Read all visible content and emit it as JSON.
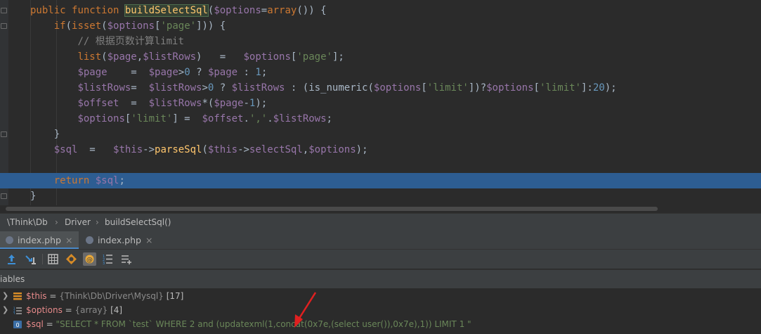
{
  "editor": {
    "lines": [
      [
        [
          "kw",
          "public "
        ],
        [
          "kw",
          "function "
        ],
        [
          "ident",
          "buildSelectSql"
        ],
        [
          "",
          "("
        ],
        [
          "var",
          "$options"
        ],
        [
          "",
          "="
        ],
        [
          "kw",
          "array"
        ],
        [
          "",
          "()) {"
        ]
      ],
      [
        [
          "",
          "    "
        ],
        [
          "kw",
          "if"
        ],
        [
          "",
          "("
        ],
        [
          "kw",
          "isset"
        ],
        [
          "",
          "("
        ],
        [
          "var",
          "$options"
        ],
        [
          "",
          "["
        ],
        [
          "str",
          "'page'"
        ],
        [
          "",
          "])) {"
        ]
      ],
      [
        [
          "",
          "        "
        ],
        [
          "cmt",
          "// 根据页数计算limit"
        ]
      ],
      [
        [
          "",
          "        "
        ],
        [
          "kw",
          "list"
        ],
        [
          "",
          "("
        ],
        [
          "var",
          "$page"
        ],
        [
          "",
          ","
        ],
        [
          "var",
          "$listRows"
        ],
        [
          "",
          ")   =   "
        ],
        [
          "var",
          "$options"
        ],
        [
          "",
          "["
        ],
        [
          "str",
          "'page'"
        ],
        [
          "",
          "];"
        ]
      ],
      [
        [
          "",
          "        "
        ],
        [
          "var",
          "$page"
        ],
        [
          "",
          "    =  "
        ],
        [
          "var",
          "$page"
        ],
        [
          "",
          ">"
        ],
        [
          "num",
          "0"
        ],
        [
          "",
          " ? "
        ],
        [
          "var",
          "$page"
        ],
        [
          "",
          " : "
        ],
        [
          "num",
          "1"
        ],
        [
          "",
          ";"
        ]
      ],
      [
        [
          "",
          "        "
        ],
        [
          "var",
          "$listRows"
        ],
        [
          "",
          "=  "
        ],
        [
          "var",
          "$listRows"
        ],
        [
          "",
          ">"
        ],
        [
          "num",
          "0"
        ],
        [
          "",
          " ? "
        ],
        [
          "var",
          "$listRows"
        ],
        [
          "",
          " : (is_numeric("
        ],
        [
          "var",
          "$options"
        ],
        [
          "",
          "["
        ],
        [
          "str",
          "'limit'"
        ],
        [
          "",
          "])?"
        ],
        [
          "var",
          "$options"
        ],
        [
          "",
          "["
        ],
        [
          "str",
          "'limit'"
        ],
        [
          "",
          "]:"
        ],
        [
          "num",
          "20"
        ],
        [
          "",
          ");"
        ]
      ],
      [
        [
          "",
          "        "
        ],
        [
          "var",
          "$offset"
        ],
        [
          "",
          "  =  "
        ],
        [
          "var",
          "$listRows"
        ],
        [
          "",
          "*("
        ],
        [
          "var",
          "$page"
        ],
        [
          "",
          "-"
        ],
        [
          "num",
          "1"
        ],
        [
          "",
          ");"
        ]
      ],
      [
        [
          "",
          "        "
        ],
        [
          "var",
          "$options"
        ],
        [
          "",
          "["
        ],
        [
          "str",
          "'limit'"
        ],
        [
          "",
          "] =  "
        ],
        [
          "var",
          "$offset"
        ],
        [
          "",
          "."
        ],
        [
          "str",
          "','"
        ],
        [
          "",
          "."
        ],
        [
          "var",
          "$listRows"
        ],
        [
          "",
          ";"
        ]
      ],
      [
        [
          "",
          "    }"
        ]
      ],
      [
        [
          "",
          "    "
        ],
        [
          "var",
          "$sql"
        ],
        [
          "",
          "  =   "
        ],
        [
          "var",
          "$this"
        ],
        [
          "",
          "->"
        ],
        [
          "fn",
          "parseSql"
        ],
        [
          "",
          "("
        ],
        [
          "var",
          "$this"
        ],
        [
          "",
          "->"
        ],
        [
          "var",
          "selectSql"
        ],
        [
          "",
          ","
        ],
        [
          "var",
          "$options"
        ],
        [
          "",
          ");"
        ]
      ],
      [
        [
          "",
          ""
        ]
      ],
      [
        [
          "",
          "    "
        ],
        [
          "kw",
          "return "
        ],
        [
          "var",
          "$sql"
        ],
        [
          "",
          ";"
        ]
      ],
      [
        [
          "",
          "}"
        ]
      ]
    ],
    "highlighted_line": 11
  },
  "breadcrumb": [
    "\\Think\\Db",
    "Driver",
    "buildSelectSql()"
  ],
  "tabs": [
    {
      "label": "index.php",
      "close": "×"
    },
    {
      "label": "index.php",
      "close": "×"
    }
  ],
  "panel": {
    "header": "iables",
    "variables": [
      {
        "name": "$this",
        "eq": " = ",
        "type": "{Think\\Db\\Driver\\Mysql}",
        "count": " [17]",
        "expandable": true,
        "icon": "object-icon"
      },
      {
        "name": "$options",
        "eq": " = ",
        "type": "{array}",
        "count": " [4]",
        "expandable": true,
        "icon": "array-icon"
      },
      {
        "name": "$sql",
        "eq": " = ",
        "value": "\"SELECT * FROM `test` WHERE 2 and (updatexml(1,concat(0x7e,(select user()),0x7e),1)) LIMIT 1  \"",
        "expandable": false,
        "icon": "string-icon"
      }
    ]
  },
  "colors": {
    "accent": "#2d5d92",
    "annotation": "#e02020"
  }
}
